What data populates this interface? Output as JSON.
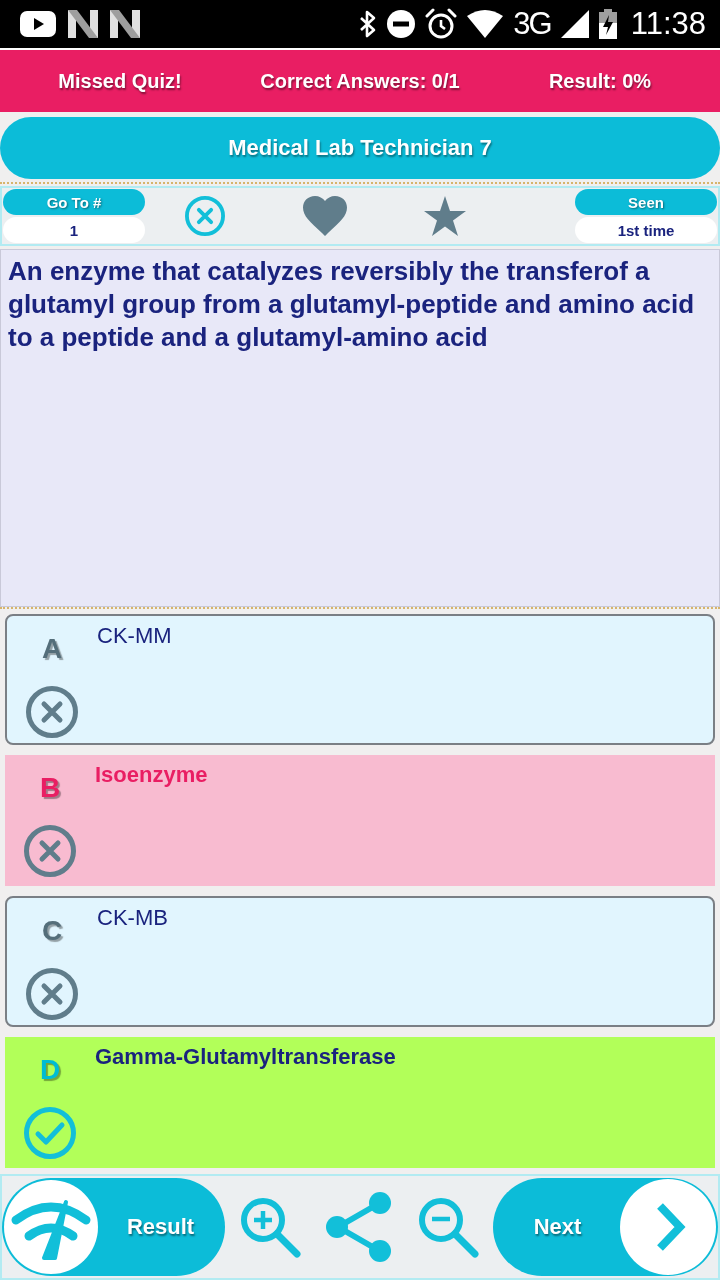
{
  "status_bar": {
    "network": "3G",
    "time": "11:38"
  },
  "header": {
    "status": "Missed Quiz!",
    "score": "Correct Answers: 0/1",
    "result": "Result: 0%"
  },
  "title": "Medical Lab Technician 7",
  "toolbar": {
    "goto": {
      "label": "Go To #",
      "value": "1"
    },
    "favorite": false,
    "starred": false,
    "seen": {
      "label": "Seen",
      "value": "1st time"
    }
  },
  "question": "An enzyme that catalyzes reversibly the transferof a glutamyl group from a glutamyl-peptide and amino acid to a peptide and a glutamyl-amino acid",
  "options": [
    {
      "letter": "A",
      "text": "CK-MM",
      "selected": false,
      "correct": false
    },
    {
      "letter": "B",
      "text": "Isoenzyme",
      "selected": true,
      "correct": false
    },
    {
      "letter": "C",
      "text": "CK-MB",
      "selected": false,
      "correct": false
    },
    {
      "letter": "D",
      "text": "Gamma-Glutamyltransferase",
      "selected": false,
      "correct": true
    }
  ],
  "bottom_bar": {
    "result_label": "Result",
    "next_label": "Next"
  }
}
